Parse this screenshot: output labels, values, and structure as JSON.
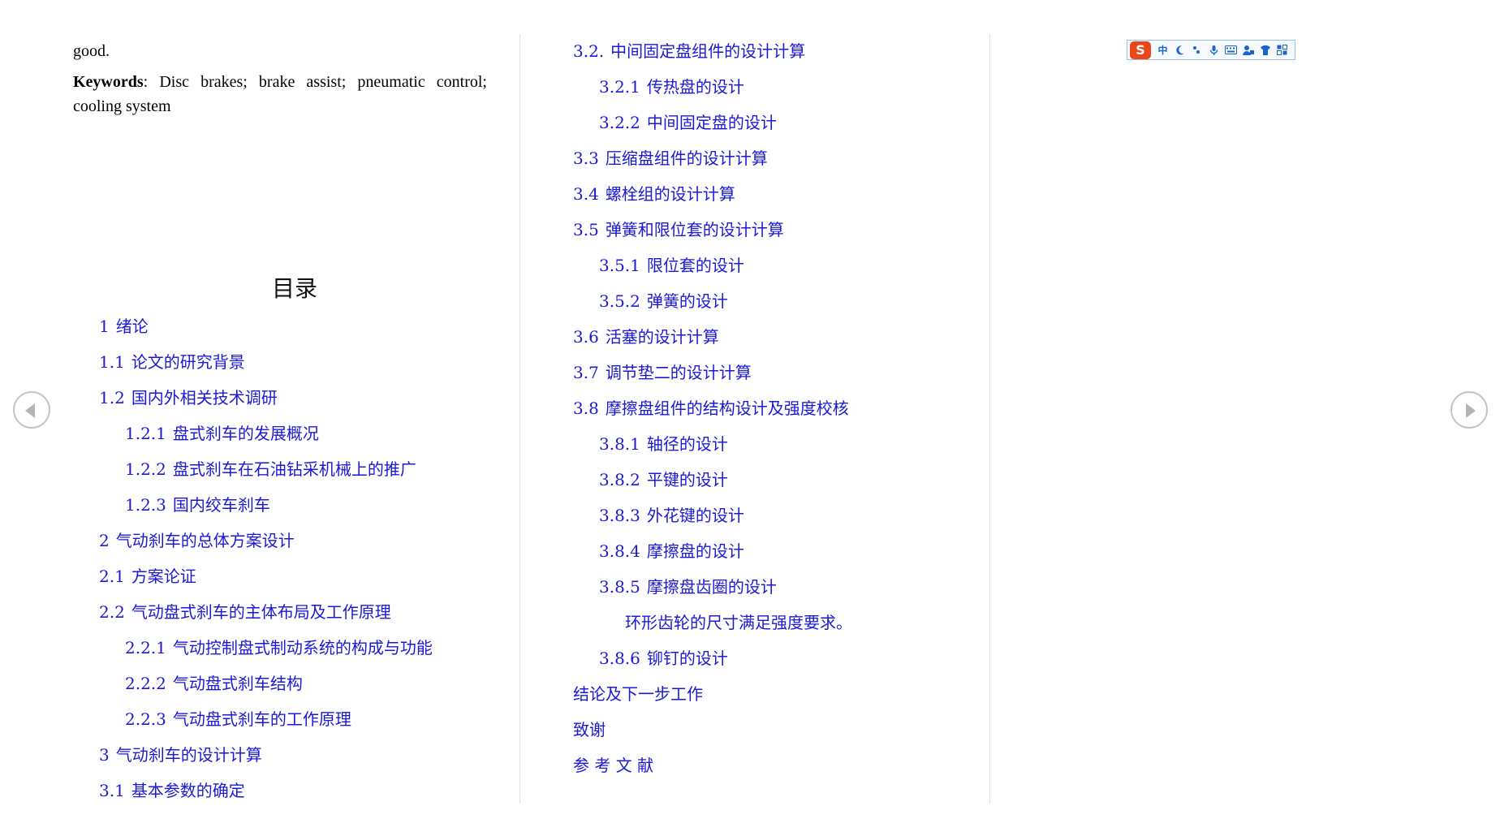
{
  "abstract": {
    "tail": "good.",
    "keywords_label": "Keywords",
    "keywords_text": ": Disc brakes; brake assist; pneumatic control; cooling system"
  },
  "toc": {
    "title": "目录",
    "left_column": [
      {
        "num": "1",
        "label": "绪论"
      },
      {
        "num": "1.1",
        "label": "论文的研究背景"
      },
      {
        "num": "1.2",
        "label": "国内外相关技术调研"
      },
      {
        "num": "1.2.1",
        "label": "盘式刹车的发展概况"
      },
      {
        "num": "1.2.2",
        "label": "盘式刹车在石油钻采机械上的推广"
      },
      {
        "num": "1.2.3",
        "label": "国内绞车刹车"
      },
      {
        "num": "2",
        "label": "气动刹车的总体方案设计"
      },
      {
        "num": "2.1",
        "label": "方案论证"
      },
      {
        "num": "2.2",
        "label": "气动盘式刹车的主体布局及工作原理"
      },
      {
        "num": "2.2.1",
        "label": "气动控制盘式制动系统的构成与功能"
      },
      {
        "num": "2.2.2",
        "label": "气动盘式刹车结构"
      },
      {
        "num": "2.2.3",
        "label": "气动盘式刹车的工作原理"
      },
      {
        "num": "3",
        "label": "气动刹车的设计计算"
      },
      {
        "num": "3.1",
        "label": "基本参数的确定"
      }
    ],
    "right_column": [
      {
        "num": "3.2.",
        "label": "中间固定盘组件的设计计算"
      },
      {
        "num": "3.2.1",
        "label": "传热盘的设计"
      },
      {
        "num": "3.2.2",
        "label": "中间固定盘的设计"
      },
      {
        "num": "3.3",
        "label": "压缩盘组件的设计计算"
      },
      {
        "num": "3.4",
        "label": "螺栓组的设计计算"
      },
      {
        "num": "3.5",
        "label": "弹簧和限位套的设计计算"
      },
      {
        "num": "3.5.1",
        "label": "限位套的设计"
      },
      {
        "num": "3.5.2",
        "label": "弹簧的设计"
      },
      {
        "num": "3.6",
        "label": "活塞的设计计算"
      },
      {
        "num": "3.7",
        "label": "调节垫二的设计计算"
      },
      {
        "num": "3.8",
        "label": "摩擦盘组件的结构设计及强度校核"
      },
      {
        "num": "3.8.1",
        "label": "轴径的设计"
      },
      {
        "num": "3.8.2",
        "label": "平键的设计"
      },
      {
        "num": "3.8.3",
        "label": "外花键的设计"
      },
      {
        "num": "3.8.4",
        "label": "摩擦盘的设计"
      },
      {
        "num": "3.8.5",
        "label": "摩擦盘齿圈的设计"
      },
      {
        "num": "",
        "label": "环形齿轮的尺寸满足强度要求。"
      },
      {
        "num": "3.8.6",
        "label": "铆钉的设计"
      },
      {
        "num": "",
        "label": "结论及下一步工作"
      },
      {
        "num": "",
        "label": "致谢"
      },
      {
        "num": "",
        "label": "参 考 文 献"
      }
    ]
  },
  "navigation": {
    "prev_icon": "chevron-left-icon",
    "next_icon": "chevron-right-icon"
  },
  "ime_toolbar": {
    "logo": "S",
    "mode": "中",
    "icons": [
      "moon-icon",
      "punctuation-icon",
      "microphone-icon",
      "keyboard-icon",
      "user-icon",
      "skin-icon",
      "grid-icon"
    ],
    "logo_color": "#e8461b",
    "accent_color": "#1a66c8"
  },
  "colors": {
    "link": "#1a1ad6",
    "text": "#000000"
  }
}
